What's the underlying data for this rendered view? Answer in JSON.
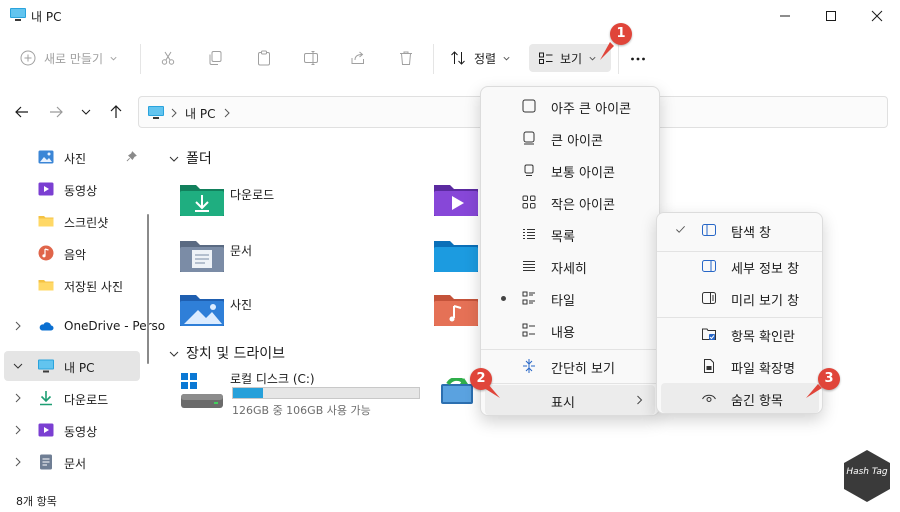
{
  "window": {
    "title": "내 PC"
  },
  "toolbar": {
    "new_label": "새로 만들기",
    "sort_label": "정렬",
    "view_label": "보기"
  },
  "address": {
    "crumb": "내 PC"
  },
  "sidebar": {
    "items": [
      {
        "label": "사진"
      },
      {
        "label": "동영상"
      },
      {
        "label": "스크린샷"
      },
      {
        "label": "음악"
      },
      {
        "label": "저장된 사진"
      },
      {
        "label": "OneDrive - Perso"
      },
      {
        "label": "내 PC"
      },
      {
        "label": "다운로드"
      },
      {
        "label": "동영상"
      },
      {
        "label": "문서"
      }
    ]
  },
  "content": {
    "folders_header": "폴더",
    "folders": [
      {
        "label": "다운로드"
      },
      {
        "label": "문서"
      },
      {
        "label": "사진"
      }
    ],
    "drives_header": "장치 및 드라이브",
    "drive": {
      "name": "로컬 디스크 (C:)",
      "usage": "126GB 중 106GB 사용 가능",
      "used_fraction": 0.16
    }
  },
  "status": {
    "count": "8개 항목"
  },
  "view_menu": {
    "items": [
      {
        "label": "아주 큰 아이콘"
      },
      {
        "label": "큰 아이콘"
      },
      {
        "label": "보통 아이콘"
      },
      {
        "label": "작은 아이콘"
      },
      {
        "label": "목록"
      },
      {
        "label": "자세히"
      },
      {
        "label": "타일"
      },
      {
        "label": "내용"
      },
      {
        "label": "간단히 보기"
      },
      {
        "label": "표시"
      }
    ]
  },
  "show_menu": {
    "items": [
      {
        "label": "탐색 창"
      },
      {
        "label": "세부 정보 창"
      },
      {
        "label": "미리 보기 창"
      },
      {
        "label": "항목 확인란"
      },
      {
        "label": "파일 확장명"
      },
      {
        "label": "숨긴 항목"
      }
    ]
  },
  "badges": [
    "1",
    "2",
    "3"
  ],
  "watermark": {
    "text": "Hash Tag"
  },
  "colors": {
    "accent": "#0067c0",
    "badge": "#e0453a",
    "folder_green": "#1e9e73"
  }
}
